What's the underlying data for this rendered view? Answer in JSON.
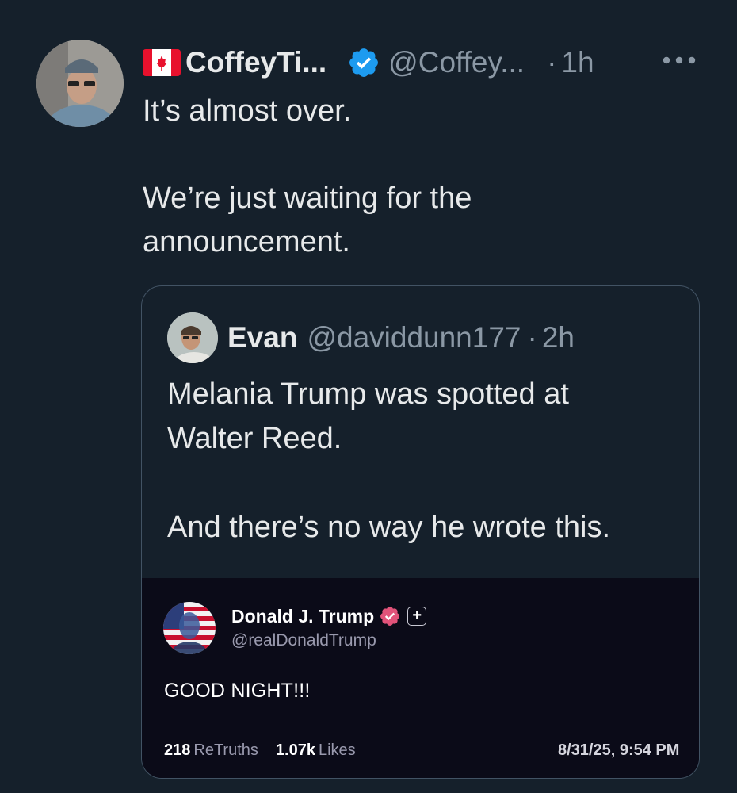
{
  "post": {
    "display_name": "CoffeyTi...",
    "flag_icon": "canada-flag-icon",
    "verified_icon": "verified-badge-icon",
    "handle": "@Coffey...",
    "separator": "·",
    "time": "1h",
    "more_icon": "more-options-icon",
    "text_line_1": "It’s almost over.",
    "text_line_2": "We’re just waiting for the",
    "text_line_3": "announcement.",
    "verified_color": "#1d9bf0"
  },
  "quote": {
    "name": "Evan",
    "handle": "@daviddunn177",
    "separator": "·",
    "time": "2h",
    "text_line_1": "Melania Trump was spotted at",
    "text_line_2": "Walter Reed.",
    "text_line_3": "And there’s no way he wrote this."
  },
  "embed": {
    "name": "Donald J. Trump",
    "handle": "@realDonaldTrump",
    "text": "GOOD NIGHT!!!",
    "retruths_count": "218",
    "retruths_label": "ReTruths",
    "likes_count": "1.07k",
    "likes_label": "Likes",
    "date": "8/31/25, 9:54 PM",
    "plus_label": "+",
    "verified_color": "#e2537a"
  }
}
